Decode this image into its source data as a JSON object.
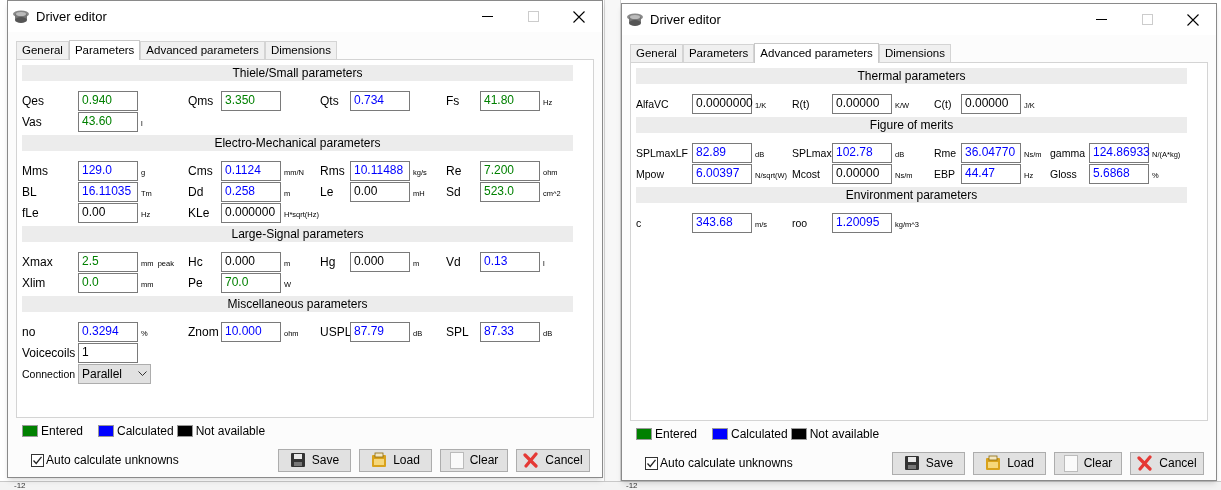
{
  "background": {
    "row_labels": [
      "-12",
      "-12"
    ]
  },
  "windows": [
    {
      "title": "Driver editor",
      "tabs": [
        {
          "label": "General",
          "selected": false
        },
        {
          "label": "Parameters",
          "selected": true
        },
        {
          "label": "Advanced parameters",
          "selected": false
        },
        {
          "label": "Dimensions",
          "selected": false
        }
      ],
      "sections": [
        {
          "title": "Thiele/Small parameters",
          "rows": [
            [
              {
                "label": "Qes",
                "value": "0.940",
                "color": "#008000"
              },
              {
                "label": "Qms",
                "value": "3.350",
                "color": "#008000"
              },
              {
                "label": "Qts",
                "value": "0.734",
                "color": "#0000ff"
              },
              {
                "label": "Fs",
                "value": "41.80",
                "unit": "Hz",
                "color": "#008000"
              }
            ],
            [
              {
                "label": "Vas",
                "value": "43.60",
                "unit": "l",
                "color": "#008000"
              }
            ]
          ]
        },
        {
          "title": "Electro-Mechanical parameters",
          "rows": [
            [
              {
                "label": "Mms",
                "value": "129.0",
                "unit": "g",
                "color": "#0000ff"
              },
              {
                "label": "Cms",
                "value": "0.1124",
                "unit": "mm/N",
                "color": "#0000ff"
              },
              {
                "label": "Rms",
                "value": "10.11488",
                "unit": "kg/s",
                "color": "#0000ff"
              },
              {
                "label": "Re",
                "value": "7.200",
                "unit": "ohm",
                "color": "#008000"
              }
            ],
            [
              {
                "label": "BL",
                "value": "16.11035",
                "unit": "Tm",
                "color": "#0000ff"
              },
              {
                "label": "Dd",
                "value": "0.258",
                "unit": "m",
                "color": "#0000ff"
              },
              {
                "label": "Le",
                "value": "0.00",
                "unit": "mH",
                "color": "#000000"
              },
              {
                "label": "Sd",
                "value": "523.0",
                "unit": "cm^2",
                "color": "#008000"
              }
            ],
            [
              {
                "label": "fLe",
                "value": "0.00",
                "unit": "Hz",
                "color": "#000000"
              },
              {
                "label": "KLe",
                "value": "0.000000",
                "unit": "H*sqrt(Hz)",
                "color": "#000000"
              }
            ]
          ]
        },
        {
          "title": "Large-Signal parameters",
          "rows": [
            [
              {
                "label": "Xmax",
                "value": "2.5",
                "unit": "mm  peak",
                "color": "#008000"
              },
              {
                "label": "Hc",
                "value": "0.000",
                "unit": "m",
                "color": "#000000"
              },
              {
                "label": "Hg",
                "value": "0.000",
                "unit": "m",
                "color": "#000000"
              },
              {
                "label": "Vd",
                "value": "0.13",
                "unit": "l",
                "color": "#0000ff"
              }
            ],
            [
              {
                "label": "Xlim",
                "value": "0.0",
                "unit": "mm",
                "color": "#008000"
              },
              {
                "label": "Pe",
                "value": "70.0",
                "unit": "W",
                "color": "#008000"
              }
            ]
          ]
        },
        {
          "title": "Miscellaneous parameters",
          "rows": [
            [
              {
                "label": "no",
                "value": "0.3294",
                "unit": "%",
                "color": "#0000ff"
              },
              {
                "label": "Znom",
                "value": "10.000",
                "unit": "ohm",
                "color": "#0000ff"
              },
              {
                "label": "USPL",
                "value": "87.79",
                "unit": "dB",
                "color": "#0000ff"
              },
              {
                "label": "SPL",
                "value": "87.33",
                "unit": "dB",
                "color": "#0000ff"
              }
            ],
            [
              {
                "label": "Voicecoils",
                "value": "1",
                "color": "#000000"
              }
            ],
            [
              {
                "label": "Connection",
                "value": "Parallel",
                "kind": "dropdown"
              }
            ]
          ]
        }
      ],
      "legend": [
        {
          "label": "Entered",
          "color": "#008000"
        },
        {
          "label": "Calculated",
          "color": "#0000ff"
        },
        {
          "label": "Not available",
          "color": "#000000"
        }
      ],
      "auto_calculate": {
        "label": "Auto calculate unknowns",
        "checked": true
      },
      "buttons": [
        {
          "label": "Save",
          "kind": "save"
        },
        {
          "label": "Load",
          "kind": "load"
        },
        {
          "label": "Clear",
          "kind": "clear"
        },
        {
          "label": "Cancel",
          "kind": "cancel"
        }
      ]
    },
    {
      "title": "Driver editor",
      "tabs": [
        {
          "label": "General",
          "selected": false
        },
        {
          "label": "Parameters",
          "selected": false
        },
        {
          "label": "Advanced parameters",
          "selected": true
        },
        {
          "label": "Dimensions",
          "selected": false
        }
      ],
      "sections": [
        {
          "title": "Thermal parameters",
          "rows": [
            [
              {
                "label": "AlfaVC",
                "value": "0.0000000",
                "unit": "1/K",
                "color": "#000000"
              },
              {
                "label": "R(t)",
                "value": "0.00000",
                "unit": "K/W",
                "color": "#000000"
              },
              {
                "label": "C(t)",
                "value": "0.00000",
                "unit": "J/K",
                "color": "#000000"
              }
            ]
          ]
        },
        {
          "title": "Figure of merits",
          "rows": [
            [
              {
                "label": "SPLmaxLF",
                "value": "82.89",
                "unit": "dB",
                "color": "#0000ff"
              },
              {
                "label": "SPLmax",
                "value": "102.78",
                "unit": "dB",
                "color": "#0000ff"
              },
              {
                "label": "Rme",
                "value": "36.04770",
                "unit": "Ns/m",
                "color": "#0000ff"
              },
              {
                "label": "gamma",
                "value": "124.86933",
                "unit": "N/(A*kg)",
                "color": "#0000ff"
              }
            ],
            [
              {
                "label": "Mpow",
                "value": "6.00397",
                "unit": "N/sqrt(W)",
                "color": "#0000ff"
              },
              {
                "label": "Mcost",
                "value": "0.00000",
                "unit": "Ns/m",
                "color": "#000000"
              },
              {
                "label": "EBP",
                "value": "44.47",
                "unit": "Hz",
                "color": "#0000ff"
              },
              {
                "label": "Gloss",
                "value": "5.6868",
                "unit": "%",
                "color": "#0000ff"
              }
            ]
          ]
        },
        {
          "title": "Environment parameters",
          "rows": [
            [
              {
                "label": "c",
                "value": "343.68",
                "unit": "m/s",
                "color": "#0000ff"
              },
              {
                "label": "roo",
                "value": "1.20095",
                "unit": "kg/m^3",
                "color": "#0000ff"
              }
            ]
          ]
        }
      ],
      "legend": [
        {
          "label": "Entered",
          "color": "#008000"
        },
        {
          "label": "Calculated",
          "color": "#0000ff"
        },
        {
          "label": "Not available",
          "color": "#000000"
        }
      ],
      "auto_calculate": {
        "label": "Auto calculate unknowns",
        "checked": true
      },
      "buttons": [
        {
          "label": "Save",
          "kind": "save"
        },
        {
          "label": "Load",
          "kind": "load"
        },
        {
          "label": "Clear",
          "kind": "clear"
        },
        {
          "label": "Cancel",
          "kind": "cancel"
        }
      ]
    }
  ]
}
